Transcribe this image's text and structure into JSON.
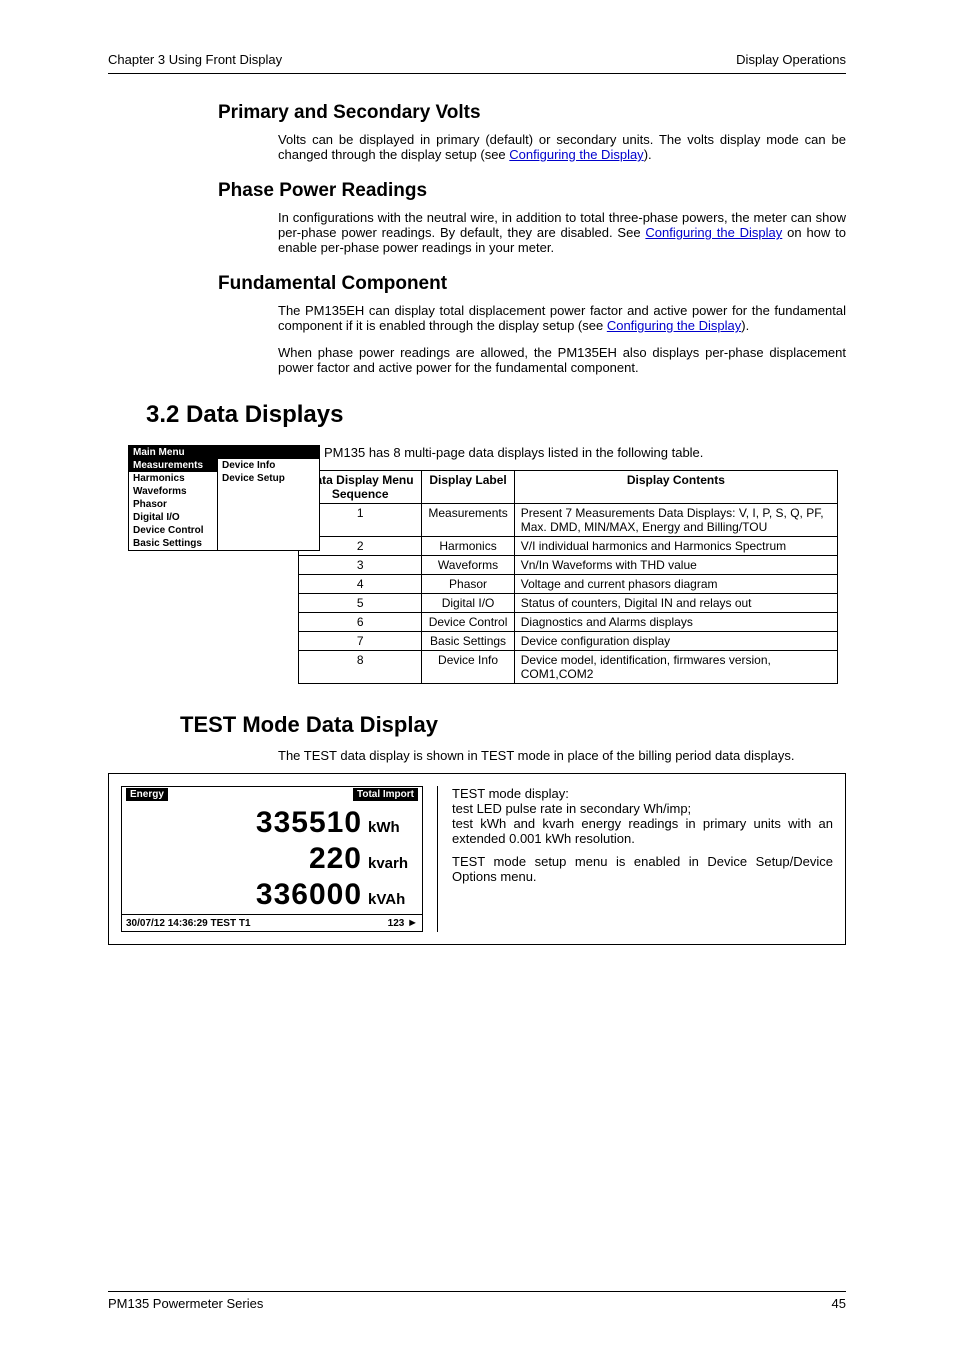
{
  "header": {
    "left": "Chapter 3   Using Front Display",
    "right": "Display Operations"
  },
  "s1": {
    "title": "Primary and Secondary Volts",
    "body_a": "Volts can be displayed in primary (default) or secondary units. The volts display mode can be changed through the display setup (see ",
    "link": "Configuring the Display",
    "body_b": ")."
  },
  "s2": {
    "title": "Phase Power Readings",
    "body_a": "In configurations with the neutral wire, in addition to total three-phase powers, the meter can show per-phase power readings. By default, they are disabled. See ",
    "link": "Configuring the Display",
    "body_b": " on how to enable per-phase power readings in your meter."
  },
  "s3": {
    "title": "Fundamental Component",
    "p1_a": "The PM135EH can display total displacement power factor and active power for the fundamental component if it is enabled through the display setup (see ",
    "p1_link": "Configuring the Display",
    "p1_b": ").",
    "p2": "When phase power readings are allowed, the PM135EH also displays per-phase displacement power factor and active power for the fundamental component."
  },
  "h2": "3.2  Data Displays",
  "intro": "The PM135 has 8 multi-page data displays listed in the following table.",
  "menu": {
    "title": "Main Menu",
    "left": [
      "Measurements",
      "Harmonics",
      "Waveforms",
      "Phasor",
      "Digital I/O",
      "Device Control",
      "Basic Settings"
    ],
    "right": [
      "Device Info",
      "Device Setup"
    ]
  },
  "table": {
    "headers": [
      "Data Display Menu Sequence",
      "Display Label",
      "Display Contents"
    ],
    "rows": [
      {
        "seq": "1",
        "label": "Measurements",
        "contents": "Present 7 Measurements Data Displays: V, I, P, S, Q, PF, Max. DMD, MIN/MAX, Energy and Billing/TOU"
      },
      {
        "seq": "2",
        "label": "Harmonics",
        "contents": "V/I individual harmonics and Harmonics Spectrum"
      },
      {
        "seq": "3",
        "label": "Waveforms",
        "contents": "Vn/In Waveforms with THD value"
      },
      {
        "seq": "4",
        "label": "Phasor",
        "contents": "Voltage and current phasors diagram"
      },
      {
        "seq": "5",
        "label": "Digital I/O",
        "contents": "Status of counters, Digital IN and relays out"
      },
      {
        "seq": "6",
        "label": "Device Control",
        "contents": "Diagnostics and Alarms displays"
      },
      {
        "seq": "7",
        "label": "Basic Settings",
        "contents": "Device configuration display"
      },
      {
        "seq": "8",
        "label": "Device Info",
        "contents": "Device model, identification, firmwares version, COM1,COM2"
      }
    ]
  },
  "test": {
    "title": "TEST Mode Data Display",
    "intro": "The TEST data display is shown in TEST mode in place of the billing period data displays.",
    "lcd": {
      "hdr_left": "Energy",
      "hdr_right": "Total Import",
      "lines": [
        {
          "value": "335510",
          "unit": "kWh"
        },
        {
          "value": "220",
          "unit": "kvarh"
        },
        {
          "value": "336000",
          "unit": "kVAh"
        }
      ],
      "footer_left": "30/07/12 14:36:29  TEST   T1",
      "footer_right": "123"
    },
    "desc_1": "TEST mode display:",
    "desc_2": "test LED pulse rate in secondary Wh/imp;",
    "desc_3": "test kWh and kvarh energy readings in primary units with an extended 0.001 kWh resolution.",
    "desc_4": "TEST mode setup menu is enabled in Device Setup/Device Options menu."
  },
  "footer": {
    "left": "PM135 Powermeter Series",
    "right": "45"
  }
}
